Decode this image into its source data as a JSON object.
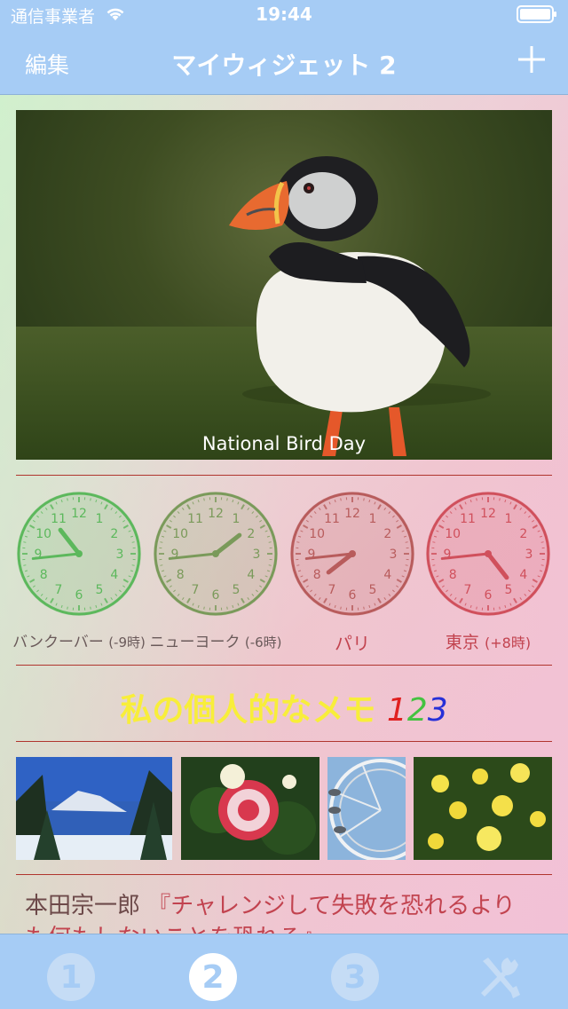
{
  "status_bar": {
    "carrier": "通信事業者",
    "time": "19:44"
  },
  "nav": {
    "left_label": "編集",
    "title": "マイウィジェット 2"
  },
  "photo_widget": {
    "caption": "National Bird Day"
  },
  "clocks": [
    {
      "label": "バンクーバー",
      "offset": "(-9時)",
      "color": "#5cb85c",
      "hour": 10,
      "minute": 44
    },
    {
      "label": "ニューヨーク",
      "offset": "(-6時)",
      "color": "#7a9a5a",
      "hour": 13,
      "minute": 44
    },
    {
      "label": "パリ",
      "offset": "",
      "color": "#b85c5c",
      "hour": 19,
      "minute": 44
    },
    {
      "label": "東京",
      "offset": "(+8時)",
      "color": "#d0505c",
      "hour": 4,
      "minute": 44
    }
  ],
  "memo": {
    "text": "私の個人的なメモ",
    "digit1": "1",
    "digit2": "2",
    "digit3": "3"
  },
  "quote": {
    "author": "本田宗一郎",
    "line1": "『チャレンジして失敗を恐れるより",
    "line2": "も何もしないことを恐れろ』"
  },
  "tabs": [
    "1",
    "2",
    "3"
  ],
  "colors": {
    "bar": "#a6ccf5",
    "accent_rule": "#b0352e"
  }
}
